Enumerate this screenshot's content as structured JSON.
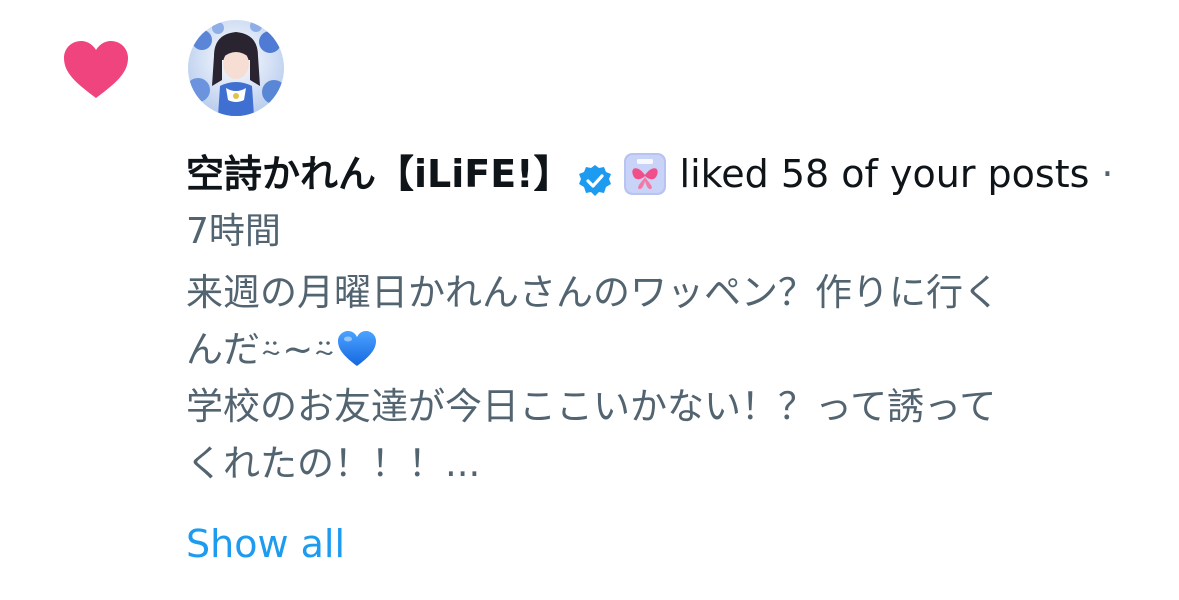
{
  "notification": {
    "type_icon": "heart-icon",
    "type_icon_color": "#f0447f",
    "avatar_icon": "avatar-image",
    "user_name": "空詩かれん【iLiFE!】",
    "verified_icon": "verified-badge-icon",
    "verified_color": "#1d9bf0",
    "affiliate_badge": "iLiFE!",
    "action_text": "liked 58 of your posts",
    "separator": "·",
    "timestamp": "7時間",
    "post_lines": [
      "来週の月曜日かれんさんのワッペン？作りに行く",
      "んだ⍨~⍨",
      "学校のお友達が今日ここいかない！？って誘って",
      "くれたの！！！..."
    ],
    "post_emoji": "blue-heart-icon",
    "show_all_label": "Show all",
    "colors": {
      "text_primary": "#0f1419",
      "text_secondary": "#536471",
      "link": "#1d9bf0"
    }
  }
}
